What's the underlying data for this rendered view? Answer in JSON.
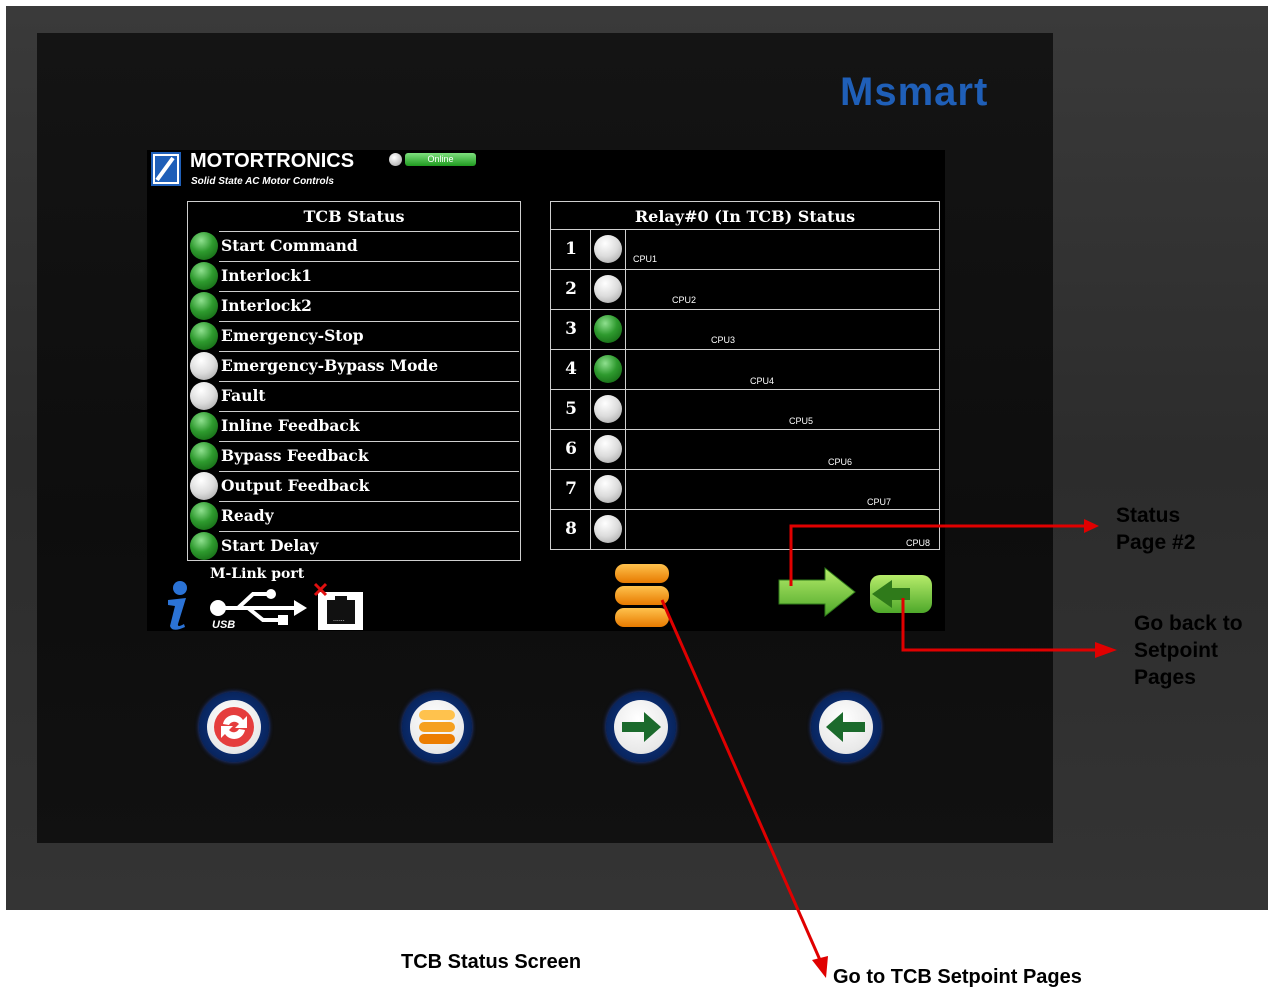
{
  "device": {
    "brand": "Msmart",
    "logo_title": "MOTORTRONICS",
    "logo_subtitle": "Solid State AC Motor Controls",
    "online_label": "Online"
  },
  "tcb_status": {
    "title": "TCB Status",
    "items": [
      {
        "label": "Start Command",
        "state": "on"
      },
      {
        "label": "Interlock1",
        "state": "on"
      },
      {
        "label": "Interlock2",
        "state": "on"
      },
      {
        "label": "Emergency-Stop",
        "state": "on"
      },
      {
        "label": "Emergency-Bypass Mode",
        "state": "off"
      },
      {
        "label": "Fault",
        "state": "off"
      },
      {
        "label": "Inline Feedback",
        "state": "on"
      },
      {
        "label": "Bypass Feedback",
        "state": "on"
      },
      {
        "label": "Output Feedback",
        "state": "off"
      },
      {
        "label": "Ready",
        "state": "on"
      },
      {
        "label": "Start Delay",
        "state": "on"
      }
    ]
  },
  "relay_status": {
    "title": "Relay#0 (In TCB) Status",
    "items": [
      {
        "num": "1",
        "cpu": "CPU1",
        "state": "off"
      },
      {
        "num": "2",
        "cpu": "CPU2",
        "state": "off"
      },
      {
        "num": "3",
        "cpu": "CPU3",
        "state": "on"
      },
      {
        "num": "4",
        "cpu": "CPU4",
        "state": "on"
      },
      {
        "num": "5",
        "cpu": "CPU5",
        "state": "off"
      },
      {
        "num": "6",
        "cpu": "CPU6",
        "state": "off"
      },
      {
        "num": "7",
        "cpu": "CPU7",
        "state": "off"
      },
      {
        "num": "8",
        "cpu": "CPU8",
        "state": "off"
      }
    ]
  },
  "bottom_bar": {
    "mlink_label": "M-Link port",
    "usb_text": "USB"
  },
  "hardware_buttons": [
    "refresh-icon",
    "menu-icon",
    "arrow-right-icon",
    "arrow-left-icon"
  ],
  "callouts": {
    "status_page": [
      "Status",
      "Page #2"
    ],
    "go_back": [
      "Go back to",
      "Setpoint",
      "Pages"
    ],
    "go_to_setpoint": "Go to TCB Setpoint Pages",
    "screen_caption": "TCB Status Screen"
  },
  "colors": {
    "led_on": "#2e9a2e",
    "led_off": "#dcdcdc",
    "brand": "#1f5fb8",
    "callout_arrow": "#e00000",
    "menu_orange": "#f28c00",
    "nav_green": "#79c943"
  }
}
